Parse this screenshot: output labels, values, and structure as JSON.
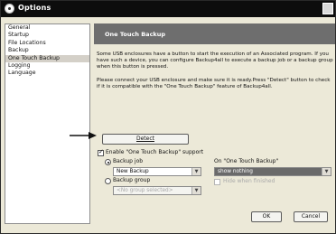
{
  "window": {
    "title": "Options"
  },
  "sidebar": {
    "items": [
      {
        "label": "General"
      },
      {
        "label": "Startup"
      },
      {
        "label": "File Locations"
      },
      {
        "label": "Backup"
      },
      {
        "label": "One Touch Backup",
        "selected": true
      },
      {
        "label": "Logging"
      },
      {
        "label": "Language"
      }
    ]
  },
  "main": {
    "banner": "One Touch Backup",
    "description": "Some USB enclosures have a button to start the execution of an Associated program. If you have such a device, you can configure Backup4all to execute a backup job or a backup group when this button is pressed.",
    "instructions": "Please connect your USB enclosure and make sure it is ready.Press \"Detect\" button to check if it is compatible with the \"One Touch Backup\" feature of Backup4all.",
    "detect_button": "Detect",
    "enable_support_label": "Enable \"One Touch Backup\" support",
    "enable_support_checked": true,
    "backup_job_label": "Backup job",
    "backup_job_selected": true,
    "backup_job_value": "New Backup",
    "backup_group_label": "Backup group",
    "backup_group_value": "<No group selected>",
    "on_touch_label": "On \"One Touch Backup\"",
    "on_touch_value": "show nothing",
    "hide_when_finished_label": "Hide when finished",
    "hide_when_finished_checked": false,
    "ok_button": "OK",
    "cancel_button": "Cancel"
  },
  "colors": {
    "titlebar": "#0d0d0d",
    "banner": "#6e6e6e",
    "dialog_bg": "#ece9d8"
  },
  "icons": {
    "window_icon": "app-icon",
    "pointer": "arrow-pointer-icon"
  }
}
